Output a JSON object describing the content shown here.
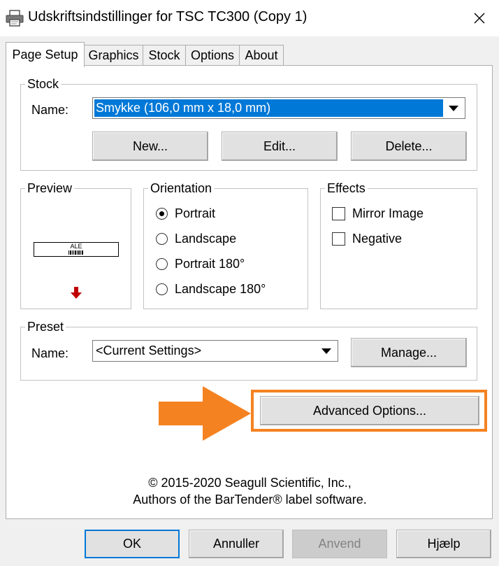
{
  "window": {
    "title": "Udskriftsindstillinger for TSC TC300 (Copy 1)"
  },
  "tabs": [
    {
      "label": "Page Setup",
      "active": true
    },
    {
      "label": "Graphics",
      "active": false
    },
    {
      "label": "Stock",
      "active": false
    },
    {
      "label": "Options",
      "active": false
    },
    {
      "label": "About",
      "active": false
    }
  ],
  "stock": {
    "group_label": "Stock",
    "name_label": "Name:",
    "name_value": "Smykke (106,0 mm x 18,0 mm)",
    "new_button": "New...",
    "edit_button": "Edit...",
    "delete_button": "Delete..."
  },
  "preview": {
    "group_label": "Preview",
    "label_text": "ALE",
    "arrow_color": "#c00000"
  },
  "orientation": {
    "group_label": "Orientation",
    "options": [
      {
        "label": "Portrait",
        "selected": true
      },
      {
        "label": "Landscape",
        "selected": false
      },
      {
        "label": "Portrait 180°",
        "selected": false
      },
      {
        "label": "Landscape 180°",
        "selected": false
      }
    ]
  },
  "effects": {
    "group_label": "Effects",
    "options": [
      {
        "label": "Mirror Image",
        "checked": false
      },
      {
        "label": "Negative",
        "checked": false
      }
    ]
  },
  "preset": {
    "group_label": "Preset",
    "name_label": "Name:",
    "name_value": "<Current Settings>",
    "manage_button": "Manage..."
  },
  "advanced": {
    "button_label": "Advanced Options...",
    "highlight_color": "#f58220"
  },
  "copyright": {
    "line1": "© 2015-2020 Seagull Scientific, Inc.,",
    "line2": "Authors of the BarTender® label software."
  },
  "footer": {
    "ok": "OK",
    "cancel": "Annuller",
    "apply": "Anvend",
    "help": "Hjælp"
  },
  "colors": {
    "accent": "#0078d7",
    "selection": "#0078d7"
  }
}
